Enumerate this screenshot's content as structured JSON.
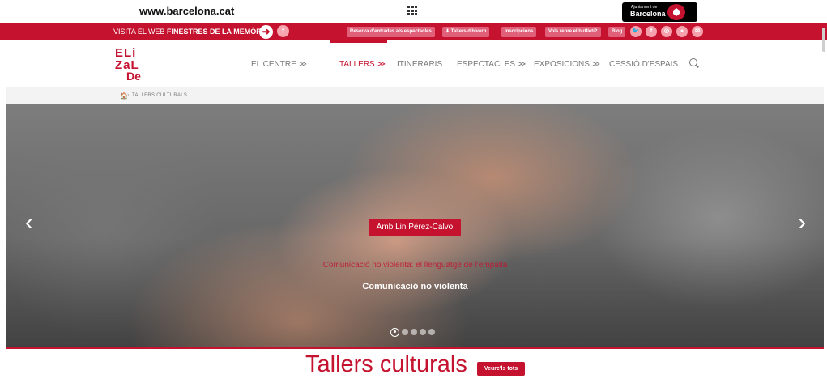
{
  "top": {
    "url": "www.barcelona.cat",
    "apps_icon": "apps-grid-icon",
    "ajuntament_small": "Ajuntament de",
    "ajuntament_big": "Barcelona"
  },
  "redbar": {
    "visita_prefix": "VISITA EL WEB ",
    "visita_bold": "FINESTRES DE LA MEMÒRIA",
    "arrow": "➜",
    "facebook": "f",
    "buttons": [
      "Reserva d'entrades als espectacles",
      "⬇ Tallers d'hivern",
      "Inscripcions",
      "Vols rebre el butlletí?",
      "Blog"
    ],
    "social": [
      "🐦",
      "f",
      "◎",
      "●",
      "✉"
    ]
  },
  "nav": {
    "logo": {
      "line1": "ELi",
      "line2": "ZaL",
      "line3": "De"
    },
    "items": [
      "EL CENTRE ≫",
      "TALLERS ≫",
      "ITINERARIS",
      "ESPECTACLES ≫",
      "EXPOSICIONS ≫",
      "CESSIÓ D'ESPAIS"
    ]
  },
  "breadcrumb": {
    "home": "🏠",
    "sep": "›",
    "current": "TALLERS CULTURALS"
  },
  "hero": {
    "prev": "‹",
    "next": "›",
    "tag": "Amb Lin Pérez-Calvo",
    "title": "Comunicació no violenta: el llenguatge de l'empatia",
    "subtitle": "Comunicació no violenta",
    "slide_count": 5,
    "active_slide": 1
  },
  "section": {
    "title": "Tallers culturals",
    "see_all": "Veure'ls tots"
  },
  "colors": {
    "brand": "#c4122f"
  }
}
